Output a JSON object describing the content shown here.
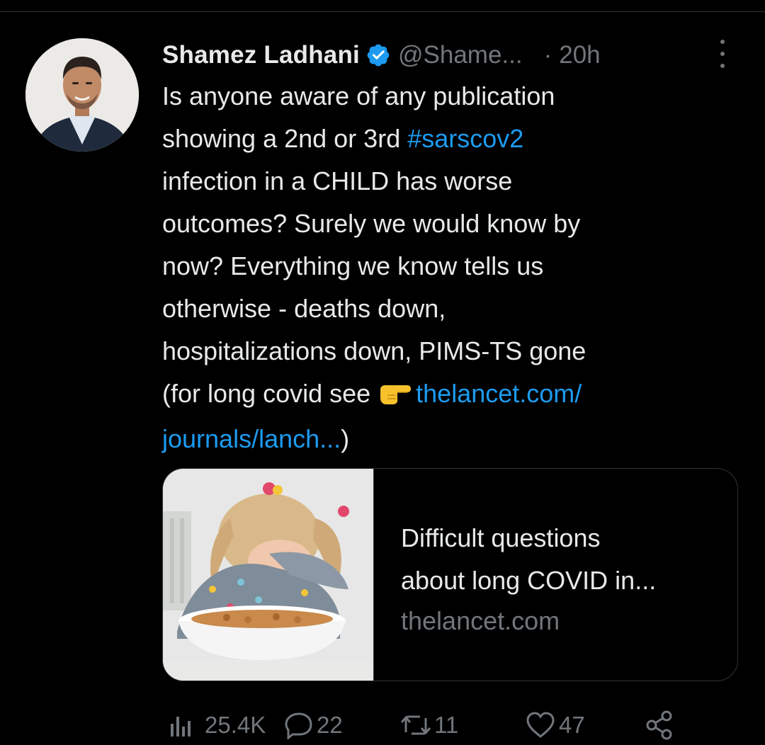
{
  "tweet": {
    "author": {
      "display_name": "Shamez Ladhani",
      "handle": "@Shame...",
      "verified": true
    },
    "separator": "·",
    "time": "20h",
    "text_lines": [
      "Is anyone aware of any publication",
      "showing a 2nd or 3rd ",
      "#sarscov2",
      "infection in a CHILD has worse",
      "outcomes? Surely we would know by",
      "now? Everything we know tells us",
      "otherwise - deaths down,",
      "hospitalizations down, PIMS-TS gone",
      "(for long covid see ",
      "thelancet.com/",
      "journals/lanch...",
      ")"
    ],
    "card": {
      "title_line1": "Difficult questions",
      "title_line2": "about long COVID in...",
      "domain": "thelancet.com"
    },
    "metrics": {
      "views": "25.4K",
      "replies": "22",
      "retweets": "11",
      "likes": "47"
    }
  },
  "colors": {
    "background": "#000000",
    "text": "#e7e9ea",
    "muted": "#71767b",
    "link": "#1d9bf0",
    "divider": "#2f3336"
  }
}
